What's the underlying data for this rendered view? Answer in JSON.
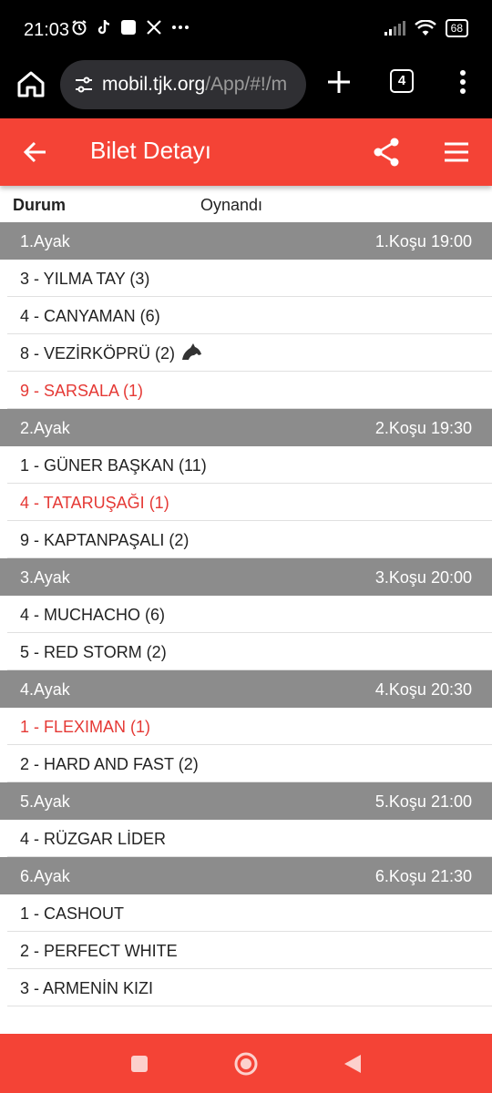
{
  "status_bar": {
    "time": "21:03",
    "battery": "68",
    "left_icons": [
      "alarm-icon",
      "tiktok-icon",
      "app-square-icon",
      "x-icon",
      "more-dots-icon"
    ],
    "right_icons": [
      "signal-icon",
      "wifi-icon",
      "battery-icon"
    ]
  },
  "browser": {
    "url_host": "mobil.tjk.org",
    "url_path": "/App/#!/m",
    "tab_count": "4"
  },
  "app_bar": {
    "title": "Bilet Detayı",
    "color": "#f44336"
  },
  "ticket": {
    "status_label": "Durum",
    "status_value": "Oynandı",
    "legs": [
      {
        "leg": "1.Ayak",
        "race": "1.Koşu 19:00",
        "horses": [
          {
            "name": "3 - YILMA TAY (3)",
            "win": false
          },
          {
            "name": "4 - CANYAMAN (6)",
            "win": false
          },
          {
            "name": "8 - VEZİRKÖPRÜ (2)",
            "win": false,
            "icon": "horse-head-icon"
          },
          {
            "name": "9 - SARSALA (1)",
            "win": true
          }
        ]
      },
      {
        "leg": "2.Ayak",
        "race": "2.Koşu 19:30",
        "horses": [
          {
            "name": "1 - GÜNER BAŞKAN (11)",
            "win": false
          },
          {
            "name": "4 - TATARUŞAĞI (1)",
            "win": true
          },
          {
            "name": "9 - KAPTANPAŞALI (2)",
            "win": false
          }
        ]
      },
      {
        "leg": "3.Ayak",
        "race": "3.Koşu 20:00",
        "horses": [
          {
            "name": "4 - MUCHACHO (6)",
            "win": false
          },
          {
            "name": "5 - RED STORM (2)",
            "win": false
          }
        ]
      },
      {
        "leg": "4.Ayak",
        "race": "4.Koşu 20:30",
        "horses": [
          {
            "name": "1 - FLEXIMAN (1)",
            "win": true
          },
          {
            "name": "2 - HARD AND FAST (2)",
            "win": false
          }
        ]
      },
      {
        "leg": "5.Ayak",
        "race": "5.Koşu 21:00",
        "horses": [
          {
            "name": "4 - RÜZGAR LİDER",
            "win": false
          }
        ]
      },
      {
        "leg": "6.Ayak",
        "race": "6.Koşu 21:30",
        "horses": [
          {
            "name": "1 - CASHOUT",
            "win": false
          },
          {
            "name": "2 - PERFECT WHITE",
            "win": false
          },
          {
            "name": "3 - ARMENİN KIZI",
            "win": false
          }
        ]
      }
    ]
  },
  "colors": {
    "header_red": "#f44336",
    "leg_header_gray": "#8c8c8c",
    "winner_red": "#e53935"
  }
}
